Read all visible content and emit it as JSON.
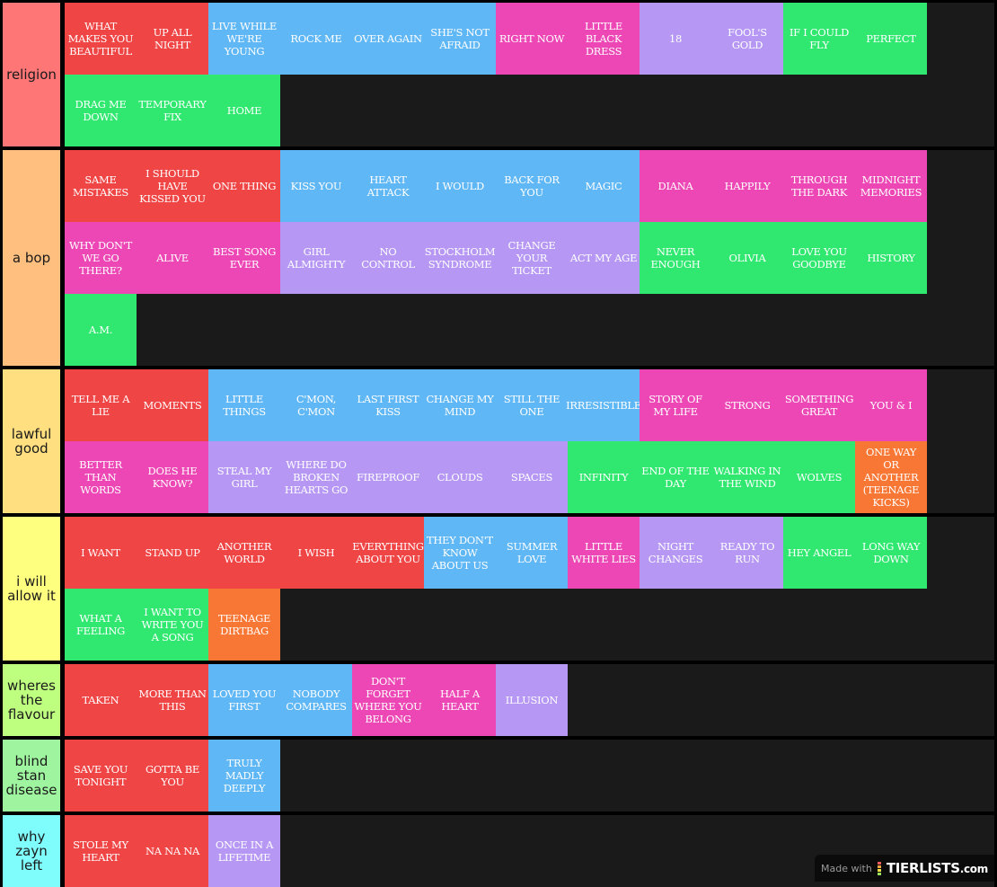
{
  "colors": {
    "red": "#f04545",
    "blue": "#60b7f6",
    "pink": "#ec47b5",
    "purple": "#b698f4",
    "green": "#30e870",
    "orange": "#f97734"
  },
  "tiers": [
    {
      "label": "religion",
      "color": "#ff7676",
      "items": [
        {
          "text": "WHAT MAKES YOU BEAUTIFUL",
          "color": "red"
        },
        {
          "text": "UP ALL NIGHT",
          "color": "red"
        },
        {
          "text": "LIVE WHILE WE'RE YOUNG",
          "color": "blue"
        },
        {
          "text": "ROCK ME",
          "color": "blue"
        },
        {
          "text": "OVER AGAIN",
          "color": "blue"
        },
        {
          "text": "SHE'S NOT AFRAID",
          "color": "blue"
        },
        {
          "text": "RIGHT NOW",
          "color": "pink"
        },
        {
          "text": "LITTLE BLACK DRESS",
          "color": "pink"
        },
        {
          "text": "18",
          "color": "purple"
        },
        {
          "text": "FOOL'S GOLD",
          "color": "purple"
        },
        {
          "text": "IF I COULD FLY",
          "color": "green"
        },
        {
          "text": "PERFECT",
          "color": "green"
        },
        {
          "text": "DRAG ME DOWN",
          "color": "green"
        },
        {
          "text": "TEMPORARY FIX",
          "color": "green"
        },
        {
          "text": "HOME",
          "color": "green"
        }
      ]
    },
    {
      "label": "a bop",
      "color": "#ffbf7f",
      "items": [
        {
          "text": "SAME MISTAKES",
          "color": "red"
        },
        {
          "text": "I SHOULD HAVE KISSED YOU",
          "color": "red"
        },
        {
          "text": "ONE THING",
          "color": "red"
        },
        {
          "text": "KISS YOU",
          "color": "blue"
        },
        {
          "text": "HEART ATTACK",
          "color": "blue"
        },
        {
          "text": "I WOULD",
          "color": "blue"
        },
        {
          "text": "BACK FOR YOU",
          "color": "blue"
        },
        {
          "text": "MAGIC",
          "color": "blue"
        },
        {
          "text": "DIANA",
          "color": "pink"
        },
        {
          "text": "HAPPILY",
          "color": "pink"
        },
        {
          "text": "THROUGH THE DARK",
          "color": "pink"
        },
        {
          "text": "MIDNIGHT MEMORIES",
          "color": "pink"
        },
        {
          "text": "WHY DON'T WE GO THERE?",
          "color": "pink"
        },
        {
          "text": "ALIVE",
          "color": "pink"
        },
        {
          "text": "BEST SONG EVER",
          "color": "pink"
        },
        {
          "text": "GIRL ALMIGHTY",
          "color": "purple"
        },
        {
          "text": "NO CONTROL",
          "color": "purple"
        },
        {
          "text": "STOCKHOLM SYNDROME",
          "color": "purple"
        },
        {
          "text": "CHANGE YOUR TICKET",
          "color": "purple"
        },
        {
          "text": "ACT MY AGE",
          "color": "purple"
        },
        {
          "text": "NEVER ENOUGH",
          "color": "green"
        },
        {
          "text": "OLIVIA",
          "color": "green"
        },
        {
          "text": "LOVE YOU GOODBYE",
          "color": "green"
        },
        {
          "text": "HISTORY",
          "color": "green"
        },
        {
          "text": "A.M.",
          "color": "green"
        }
      ]
    },
    {
      "label": "lawful good",
      "color": "#ffdf7f",
      "items": [
        {
          "text": "TELL ME A LIE",
          "color": "red"
        },
        {
          "text": "MOMENTS",
          "color": "red"
        },
        {
          "text": "LITTLE THINGS",
          "color": "blue"
        },
        {
          "text": "C'MON, C'MON",
          "color": "blue"
        },
        {
          "text": "LAST FIRST KISS",
          "color": "blue"
        },
        {
          "text": "CHANGE MY MIND",
          "color": "blue"
        },
        {
          "text": "STILL THE ONE",
          "color": "blue"
        },
        {
          "text": "IRRESISTIBLE",
          "color": "blue"
        },
        {
          "text": "STORY OF MY LIFE",
          "color": "pink"
        },
        {
          "text": "STRONG",
          "color": "pink"
        },
        {
          "text": "SOMETHING GREAT",
          "color": "pink"
        },
        {
          "text": "YOU & I",
          "color": "pink"
        },
        {
          "text": "BETTER THAN WORDS",
          "color": "pink"
        },
        {
          "text": "DOES HE KNOW?",
          "color": "pink"
        },
        {
          "text": "STEAL MY GIRL",
          "color": "purple"
        },
        {
          "text": "WHERE DO BROKEN HEARTS GO",
          "color": "purple"
        },
        {
          "text": "FIREPROOF",
          "color": "purple"
        },
        {
          "text": "CLOUDS",
          "color": "purple"
        },
        {
          "text": "SPACES",
          "color": "purple"
        },
        {
          "text": "INFINITY",
          "color": "green"
        },
        {
          "text": "END OF THE DAY",
          "color": "green"
        },
        {
          "text": "WALKING IN THE WIND",
          "color": "green"
        },
        {
          "text": "WOLVES",
          "color": "green"
        },
        {
          "text": "ONE WAY OR ANOTHER (TEENAGE KICKS)",
          "color": "orange"
        }
      ]
    },
    {
      "label": "i will allow it",
      "color": "#ffff7f",
      "items": [
        {
          "text": "I WANT",
          "color": "red"
        },
        {
          "text": "STAND UP",
          "color": "red"
        },
        {
          "text": "ANOTHER WORLD",
          "color": "red"
        },
        {
          "text": "I WISH",
          "color": "red"
        },
        {
          "text": "EVERYTHING ABOUT YOU",
          "color": "red"
        },
        {
          "text": "THEY DON'T KNOW ABOUT US",
          "color": "blue"
        },
        {
          "text": "SUMMER LOVE",
          "color": "blue"
        },
        {
          "text": "LITTLE WHITE LIES",
          "color": "pink"
        },
        {
          "text": "NIGHT CHANGES",
          "color": "purple"
        },
        {
          "text": "READY TO RUN",
          "color": "purple"
        },
        {
          "text": "HEY ANGEL",
          "color": "green"
        },
        {
          "text": "LONG WAY DOWN",
          "color": "green"
        },
        {
          "text": "WHAT A FEELING",
          "color": "green"
        },
        {
          "text": "I WANT TO WRITE YOU A SONG",
          "color": "green"
        },
        {
          "text": "TEENAGE DIRTBAG",
          "color": "orange"
        }
      ]
    },
    {
      "label": "wheres the flavour",
      "color": "#bfff7f",
      "items": [
        {
          "text": "TAKEN",
          "color": "red"
        },
        {
          "text": "MORE THAN THIS",
          "color": "red"
        },
        {
          "text": "LOVED YOU FIRST",
          "color": "blue"
        },
        {
          "text": "NOBODY COMPARES",
          "color": "blue"
        },
        {
          "text": "DON'T FORGET WHERE YOU BELONG",
          "color": "pink"
        },
        {
          "text": "HALF A HEART",
          "color": "pink"
        },
        {
          "text": "ILLUSION",
          "color": "purple"
        }
      ]
    },
    {
      "label": "blind stan disease",
      "color": "#9ff59f",
      "items": [
        {
          "text": "SAVE YOU TONIGHT",
          "color": "red"
        },
        {
          "text": "GOTTA BE YOU",
          "color": "red"
        },
        {
          "text": "TRULY MADLY DEEPLY",
          "color": "blue"
        }
      ]
    },
    {
      "label": "why zayn left",
      "color": "#7ffcfc",
      "items": [
        {
          "text": "STOLE MY HEART",
          "color": "red"
        },
        {
          "text": "NA NA NA",
          "color": "red"
        },
        {
          "text": "ONCE IN A LIFETIME",
          "color": "purple"
        }
      ]
    }
  ],
  "watermark": {
    "prefix": "Made with",
    "brand": "TIERLISTS",
    "suffix": ".com",
    "logo_colors": [
      "#f05a5a",
      "#f5a542",
      "#f2e14a",
      "#9be05a"
    ]
  }
}
